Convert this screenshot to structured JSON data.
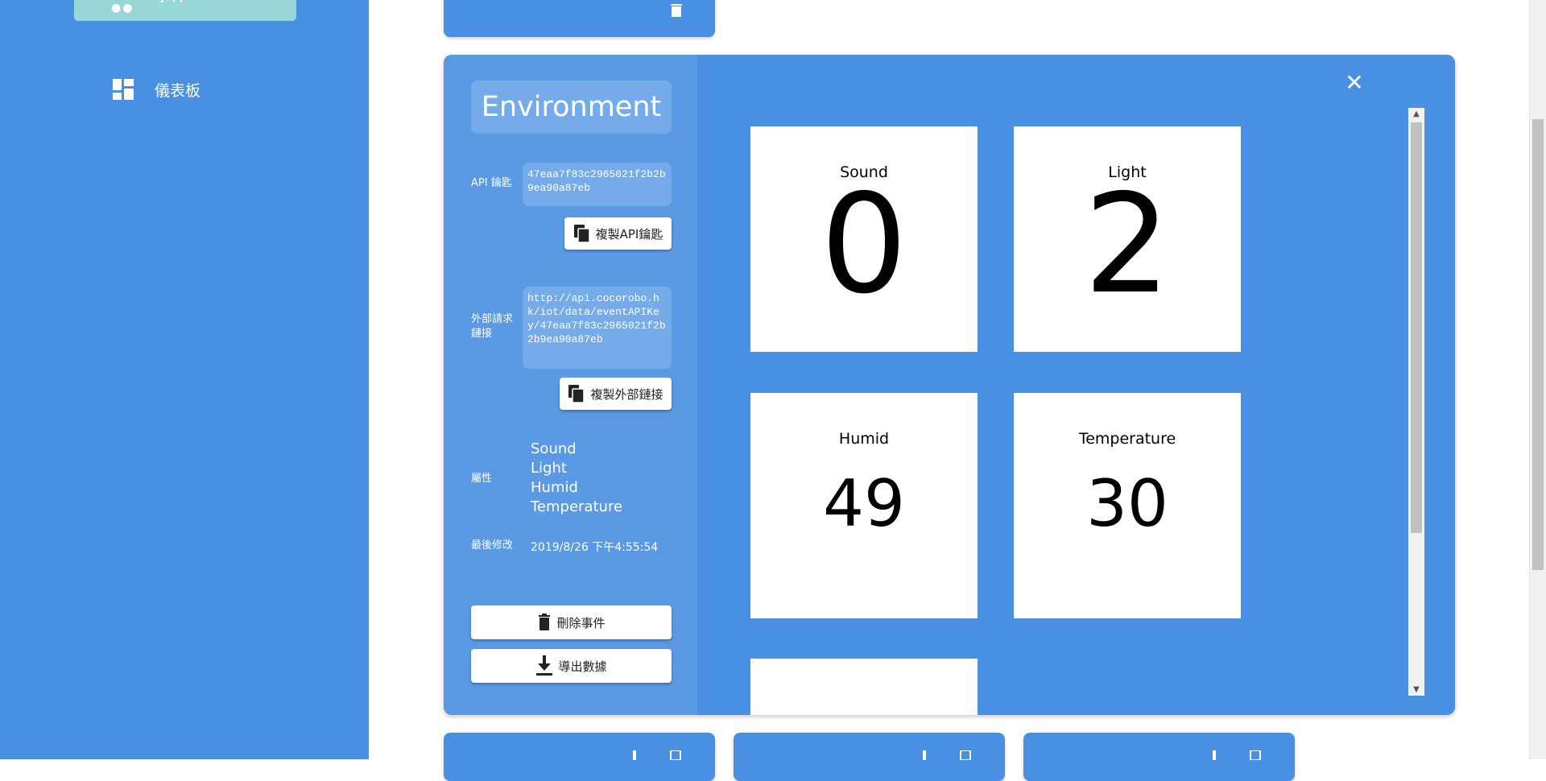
{
  "sidebar": {
    "active_label": "事件",
    "dashboard_label": "儀表板"
  },
  "event": {
    "title": "Environment",
    "api_key_label": "API 鑰匙",
    "api_key": "47eaa7f83c2965021f2b2b9ea90a87eb",
    "copy_api_button": "複製API鑰匙",
    "external_link_label": "外部請求鏈接",
    "external_link": "http://api.cocorobo.hk/iot/data/eventAPIKey/47eaa7f83c2965021f2b2b9ea90a87eb",
    "copy_link_button": "複製外部鏈接",
    "attributes_label": "屬性",
    "attributes": [
      "Sound",
      "Light",
      "Humid",
      "Temperature"
    ],
    "last_modified_label": "最後修改",
    "last_modified": "2019/8/26 下午4:55:54",
    "delete_button": "刪除事件",
    "export_button": "導出數據"
  },
  "tiles": [
    {
      "name": "Sound",
      "value": "0"
    },
    {
      "name": "Light",
      "value": "2"
    },
    {
      "name": "Humid",
      "value": "49"
    },
    {
      "name": "Temperature",
      "value": "30"
    }
  ],
  "colors": {
    "primary": "#4a90e2",
    "panel": "#5a9ae4",
    "accent": "#97d7d7"
  }
}
